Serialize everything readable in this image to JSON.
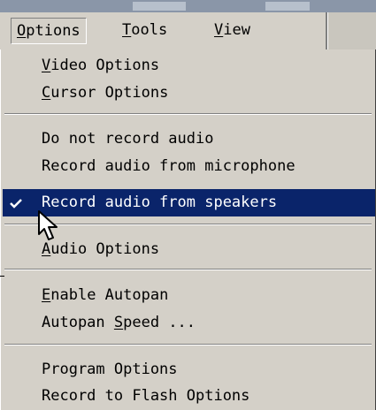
{
  "menubar": {
    "menus": [
      {
        "before": "",
        "accel": "O",
        "after": "ptions"
      },
      {
        "before": "",
        "accel": "T",
        "after": "ools"
      },
      {
        "before": "",
        "accel": "V",
        "after": "iew"
      }
    ]
  },
  "dropdown": {
    "items": [
      {
        "before": "",
        "accel": "V",
        "after": "ideo Options"
      },
      {
        "before": "",
        "accel": "C",
        "after": "ursor Options"
      },
      {
        "before": "Do not record audio",
        "accel": "",
        "after": ""
      },
      {
        "before": "Record audio from microphone",
        "accel": "",
        "after": ""
      },
      {
        "before": "Record audio from speakers",
        "accel": "",
        "after": "",
        "checked": true,
        "highlighted": true
      },
      {
        "before": "",
        "accel": "A",
        "after": "udio Options"
      },
      {
        "before": "",
        "accel": "E",
        "after": "nable Autopan"
      },
      {
        "before": "Autopan ",
        "accel": "S",
        "after": "peed ..."
      },
      {
        "before": "Program Options",
        "accel": "",
        "after": ""
      },
      {
        "before": "Record to Flash Options",
        "accel": "",
        "after": ""
      }
    ]
  },
  "icons": {
    "check": "checkmark-icon",
    "cursor": "mouse-pointer-icon"
  },
  "colors": {
    "menu_background": "#d4d0c8",
    "highlight": "#0a246a",
    "highlight_text": "#ffffff"
  }
}
